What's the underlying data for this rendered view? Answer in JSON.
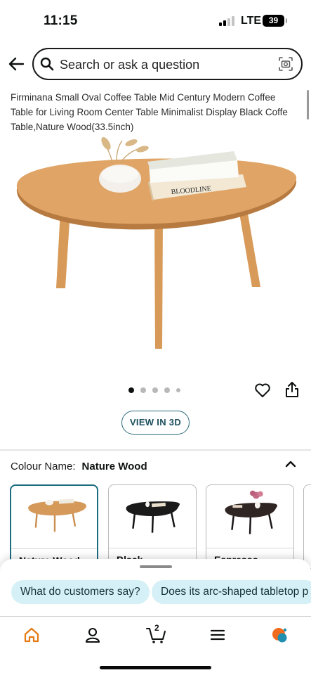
{
  "status_bar": {
    "time": "11:15",
    "network": "LTE",
    "battery": "39"
  },
  "search": {
    "placeholder": "Search or ask a question"
  },
  "product": {
    "title": "Firminana Small Oval Coffee Table Mid Century Modern Coffee Table for Living Room Center Table Minimalist Display Black Coffe Table,Nature Wood(33.5inch)",
    "book_spine": "BLOODLINE",
    "image_count": 5,
    "active_image": 1
  },
  "actions": {
    "view_3d_label": "VIEW IN 3D"
  },
  "colour": {
    "label": "Colour Name:",
    "selected": "Nature Wood",
    "options": [
      {
        "label": "Nature Wood",
        "top_color": "#d59a5a"
      },
      {
        "label": "Black",
        "top_color": "#1a1a1a"
      },
      {
        "label": "Espresso",
        "top_color": "#2f2624"
      }
    ]
  },
  "suggestions": [
    "What do customers say?",
    "Does its arc-shaped tabletop p"
  ],
  "nav": {
    "cart_count": "2"
  },
  "colors": {
    "accent_teal": "#1c6c80",
    "chip_bg": "#d5f0f6",
    "home_orange": "#e47911"
  }
}
